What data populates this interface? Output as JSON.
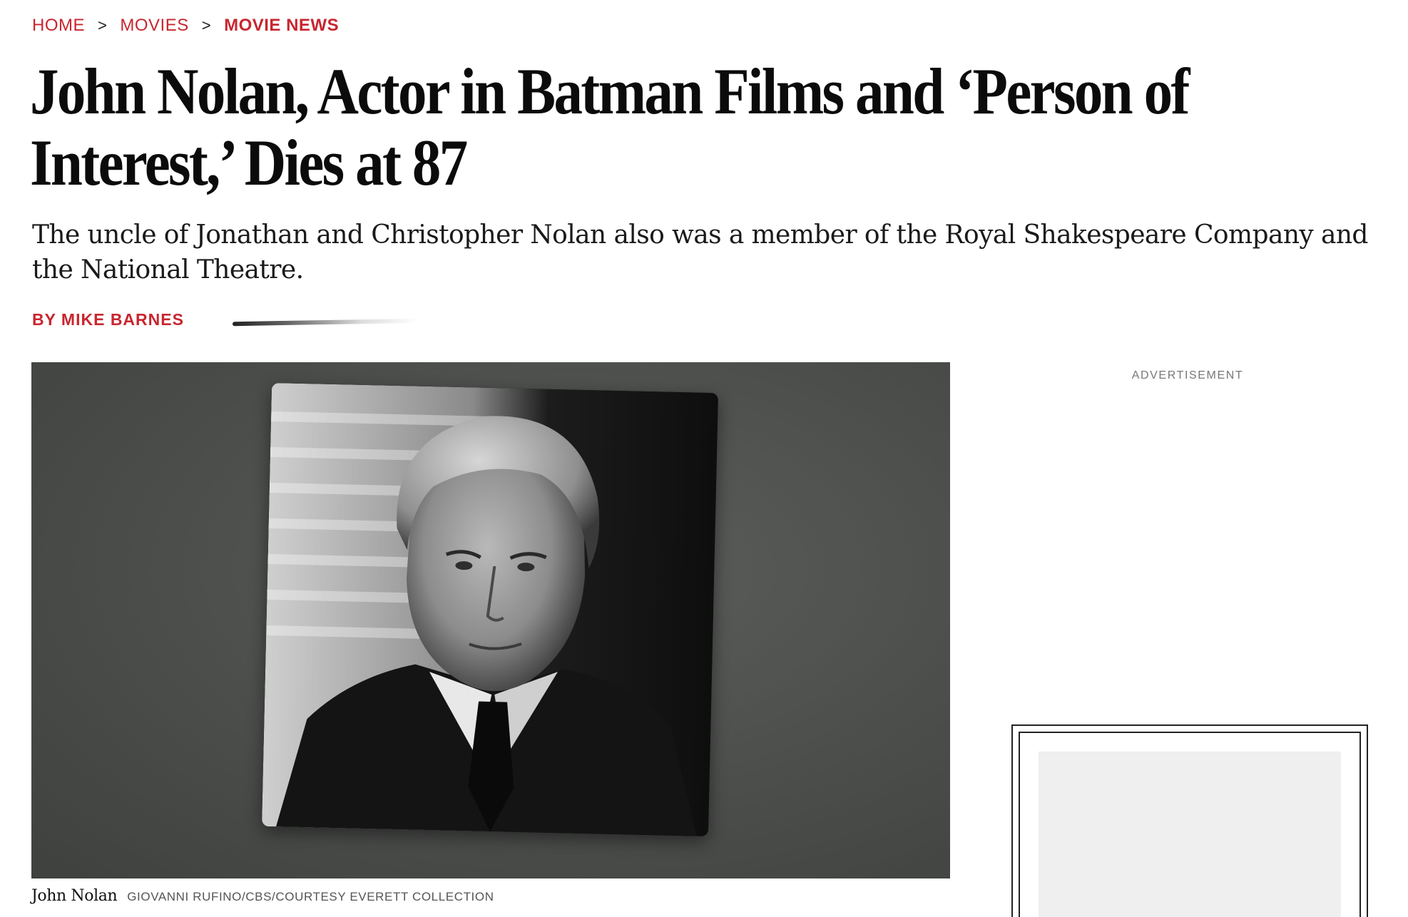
{
  "breadcrumb": {
    "items": [
      {
        "label": "HOME"
      },
      {
        "label": "MOVIES"
      },
      {
        "label": "MOVIE NEWS"
      }
    ],
    "separator": ">"
  },
  "article": {
    "headline": "John Nolan, Actor in Batman Films and ‘Person of Interest,’ Dies at 87",
    "dek": "The uncle of Jonathan and Christopher Nolan also was a member of the Royal Shakespeare Company and the National Theatre.",
    "byline": "BY MIKE BARNES"
  },
  "hero_image": {
    "caption_name": "John Nolan",
    "caption_credit": "GIOVANNI RUFINO/CBS/COURTESY EVERETT COLLECTION"
  },
  "sidebar": {
    "ad_label": "ADVERTISEMENT"
  },
  "colors": {
    "accent": "#c8262f",
    "text": "#111111",
    "ad_placeholder": "#efefef"
  }
}
